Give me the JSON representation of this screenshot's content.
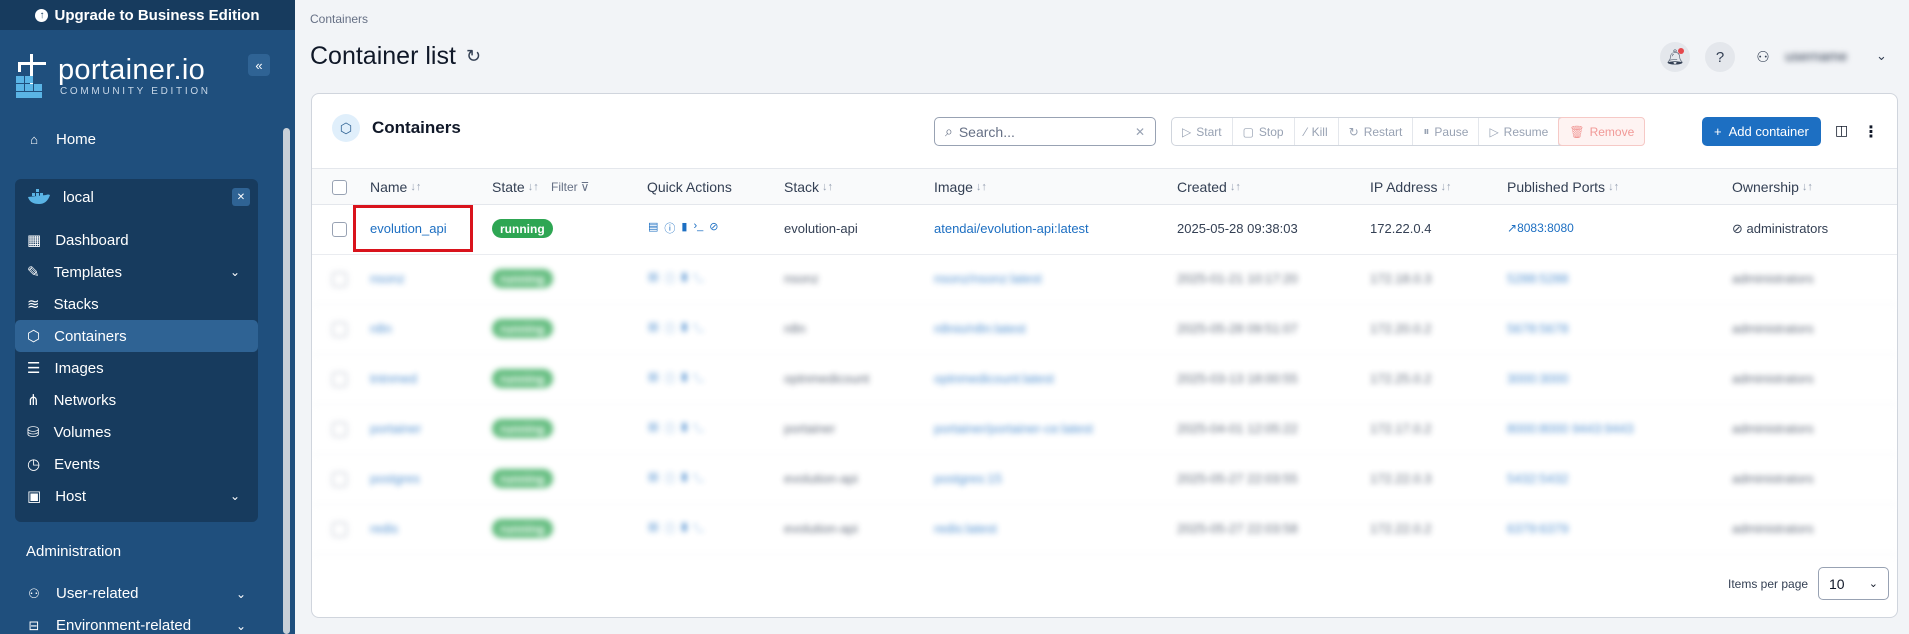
{
  "sidebar": {
    "upgrade": "Upgrade to Business Edition",
    "brand": "portainer.io",
    "edition": "COMMUNITY EDITION",
    "home": "Home",
    "environment": "local",
    "items": [
      {
        "label": "Dashboard",
        "icon": "dashboard-icon"
      },
      {
        "label": "Templates",
        "icon": "templates-icon",
        "expandable": true
      },
      {
        "label": "Stacks",
        "icon": "stacks-icon"
      },
      {
        "label": "Containers",
        "icon": "containers-icon",
        "active": true
      },
      {
        "label": "Images",
        "icon": "images-icon"
      },
      {
        "label": "Networks",
        "icon": "networks-icon"
      },
      {
        "label": "Volumes",
        "icon": "volumes-icon"
      },
      {
        "label": "Events",
        "icon": "events-icon"
      },
      {
        "label": "Host",
        "icon": "host-icon",
        "expandable": true
      }
    ],
    "admin_title": "Administration",
    "admin_items": [
      {
        "label": "User-related",
        "expandable": true
      },
      {
        "label": "Environment-related",
        "expandable": true
      }
    ]
  },
  "header": {
    "breadcrumb": "Containers",
    "title": "Container list"
  },
  "panel": {
    "title": "Containers",
    "search_placeholder": "Search...",
    "actions": [
      "Start",
      "Stop",
      "Kill",
      "Restart",
      "Pause",
      "Resume",
      "Remove"
    ],
    "add_button": "Add container",
    "columns": [
      "Name",
      "State",
      "Filter",
      "Quick Actions",
      "Stack",
      "Image",
      "Created",
      "IP Address",
      "Published Ports",
      "Ownership"
    ],
    "rows": [
      {
        "name": "evolution_api",
        "state": "running",
        "stack": "evolution-api",
        "image": "atendai/evolution-api:latest",
        "created": "2025-05-28 09:38:03",
        "ip": "172.22.0.4",
        "ports": "8083:8080",
        "ownership": "administrators"
      },
      {
        "name": "nsonz",
        "state": "running",
        "stack": "nsonz",
        "image": "nsonz/nsonz:latest",
        "created": "2025-01-21 10:17:20",
        "ip": "172.18.0.3",
        "ports": "5288:5288",
        "ownership": "administrators"
      },
      {
        "name": "n8n",
        "state": "running",
        "stack": "n8n",
        "image": "n8nio/n8n:latest",
        "created": "2025-05-28 09:51:07",
        "ip": "172.20.0.2",
        "ports": "5678:5678",
        "ownership": "administrators"
      },
      {
        "name": "tntnmed",
        "state": "running",
        "stack": "optnmedicount",
        "image": "optnmedicount:latest",
        "created": "2025-03-13 18:00:55",
        "ip": "172.25.0.2",
        "ports": "3000:3000",
        "ownership": "administrators"
      },
      {
        "name": "portainer",
        "state": "running",
        "stack": "portainer",
        "image": "portainer/portainer-ce:latest",
        "created": "2025-04-01 12:05:22",
        "ip": "172.17.0.2",
        "ports": "8000:8000 9443:9443",
        "ownership": "administrators"
      },
      {
        "name": "postgres",
        "state": "running",
        "stack": "evolution-api",
        "image": "postgres:15",
        "created": "2025-05-27 22:03:55",
        "ip": "172.22.0.3",
        "ports": "5432:5432",
        "ownership": "administrators"
      },
      {
        "name": "redis",
        "state": "running",
        "stack": "evolution-api",
        "image": "redis:latest",
        "created": "2025-05-27 22:03:58",
        "ip": "172.22.0.2",
        "ports": "6379:6379",
        "ownership": "administrators"
      }
    ],
    "items_per_page_label": "Items per page",
    "items_per_page": "10"
  },
  "user": {
    "name": "username"
  },
  "colors": {
    "sidebar": "#1f4f7d",
    "accent": "#1d6fc2",
    "running": "#2ea653",
    "highlight": "#d9131c"
  }
}
